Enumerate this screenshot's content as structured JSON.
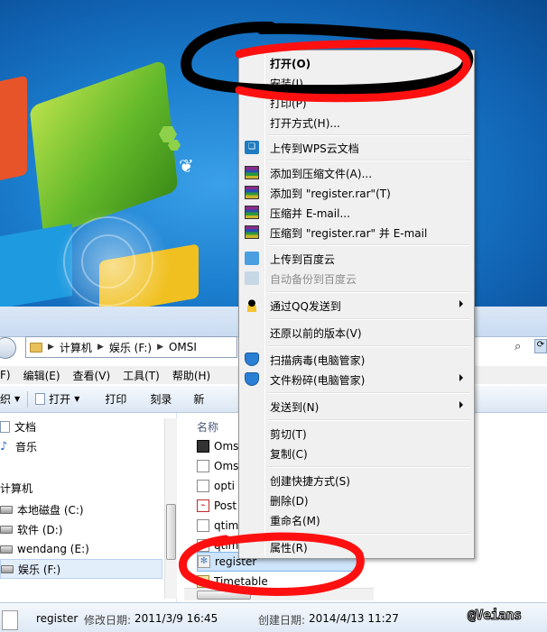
{
  "context_menu": {
    "items": [
      {
        "label": "打开(O)",
        "bold": true
      },
      {
        "label": "安装(I)"
      },
      {
        "label": "打印(P)"
      },
      {
        "label": "打开方式(H)..."
      },
      {
        "label": "上传到WPS云文档",
        "icon": "wps-cloud-icon"
      },
      {
        "label": "添加到压缩文件(A)...",
        "icon": "winrar-icon"
      },
      {
        "label": "添加到 \"register.rar\"(T)",
        "icon": "winrar-icon"
      },
      {
        "label": "压缩并 E-mail...",
        "icon": "winrar-icon"
      },
      {
        "label": "压缩到 \"register.rar\" 并 E-mail",
        "icon": "winrar-icon"
      },
      {
        "label": "上传到百度云",
        "icon": "baidu-cloud-icon"
      },
      {
        "label": "自动备份到百度云",
        "icon": "baidu-cloud-icon",
        "disabled": true
      },
      {
        "label": "通过QQ发送到",
        "icon": "qq-icon",
        "submenu": true
      },
      {
        "label": "还原以前的版本(V)"
      },
      {
        "label": "扫描病毒(电脑管家)",
        "icon": "shield-icon"
      },
      {
        "label": "文件粉碎(电脑管家)",
        "icon": "shield-icon",
        "submenu": true
      },
      {
        "label": "发送到(N)",
        "submenu": true
      },
      {
        "label": "剪切(T)"
      },
      {
        "label": "复制(C)"
      },
      {
        "label": "创建快捷方式(S)"
      },
      {
        "label": "删除(D)"
      },
      {
        "label": "重命名(M)"
      },
      {
        "label": "属性(R)"
      }
    ]
  },
  "explorer": {
    "breadcrumb": [
      "计算机",
      "娱乐 (F:)",
      "OMSI"
    ],
    "menu": [
      "F)",
      "编辑(E)",
      "查看(V)",
      "工具(T)",
      "帮助(H)"
    ],
    "toolbar": [
      "织",
      "打开",
      "打印",
      "刻录",
      "新"
    ],
    "nav_items": [
      {
        "label": "文档",
        "icon": "document-icon"
      },
      {
        "label": "音乐",
        "icon": "music-icon"
      },
      {
        "label": "计算机",
        "icon": "computer-icon"
      },
      {
        "label": "本地磁盘 (C:)",
        "icon": "drive-icon"
      },
      {
        "label": "软件 (D:)",
        "icon": "drive-icon"
      },
      {
        "label": "wendang (E:)",
        "icon": "drive-icon"
      },
      {
        "label": "娱乐 (F:)",
        "icon": "drive-icon",
        "selected": true
      }
    ],
    "column_header": "名称",
    "files": [
      {
        "name": "Oms",
        "icon": "exe-icon"
      },
      {
        "name": "Oms",
        "icon": "text-file-icon"
      },
      {
        "name": "opti",
        "icon": "text-file-icon"
      },
      {
        "name": "Post",
        "icon": "pdf-icon"
      },
      {
        "name": "qtim",
        "icon": "text-file-icon"
      },
      {
        "name": "qtim",
        "icon": "text-file-icon"
      },
      {
        "name": "register",
        "icon": "registry-file-icon",
        "selected": true
      },
      {
        "name": "Timetable",
        "icon": "timetable-icon"
      }
    ],
    "details": {
      "name": "register",
      "modified_label": "修改日期:",
      "modified_value": "2011/3/9 16:45",
      "created_label": "创建日期:",
      "created_value": "2014/4/13 11:27"
    }
  },
  "watermark": "@Veians",
  "colors": {
    "annotation": "#ff1010",
    "menu_bg": "#f0f0f0",
    "selection": "#cde4fb"
  }
}
